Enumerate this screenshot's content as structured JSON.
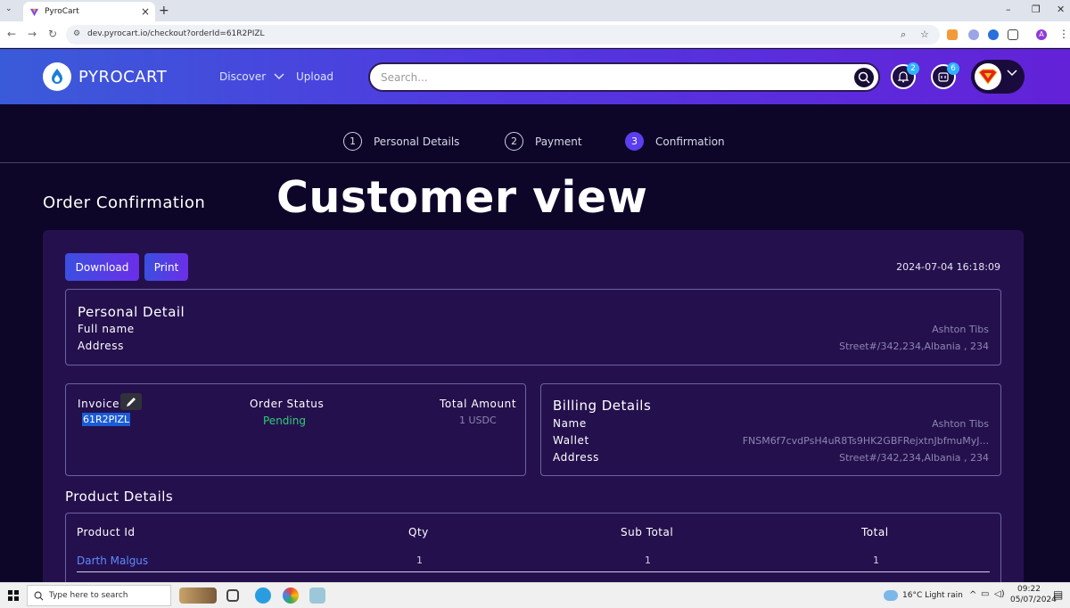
{
  "browser": {
    "tab_title": "PyroCart",
    "url": "dev.pyrocart.io/checkout?orderId=61R2PIZL",
    "profile_initial": "A"
  },
  "header": {
    "brand": "PYROCART",
    "nav": {
      "discover": "Discover",
      "upload": "Upload"
    },
    "search_placeholder": "Search...",
    "notifications_count": "2",
    "cart_count": "6"
  },
  "stepper": [
    {
      "num": "1",
      "label": "Personal Details"
    },
    {
      "num": "2",
      "label": "Payment"
    },
    {
      "num": "3",
      "label": "Confirmation"
    }
  ],
  "page": {
    "title": "Order Confirmation",
    "overlay": "Customer view"
  },
  "actions": {
    "download": "Download",
    "print": "Print",
    "timestamp": "2024-07-04 16:18:09"
  },
  "personal": {
    "title": "Personal Detail",
    "full_name_label": "Full name",
    "address_label": "Address",
    "full_name": "Ashton Tibs",
    "address": "Street#/342,234,Albania , 234"
  },
  "invoice": {
    "invoice_label": "Invoice",
    "invoice_id": "61R2PIZL",
    "status_label": "Order Status",
    "status": "Pending",
    "total_label": "Total Amount",
    "total": "1 USDC"
  },
  "billing": {
    "title": "Billing Details",
    "name_label": "Name",
    "wallet_label": "Wallet",
    "address_label": "Address",
    "name": "Ashton Tibs",
    "wallet": "FNSM6f7cvdPsH4uR8Ts9HK2GBFRejxtnJbfmuMyJ...",
    "address": "Street#/342,234,Albania , 234"
  },
  "products": {
    "title": "Product Details",
    "headers": [
      "Product Id",
      "Qty",
      "Sub Total",
      "Total"
    ],
    "rows": [
      {
        "product": "Darth Malgus",
        "qty": "1",
        "subtotal": "1",
        "total": "1"
      }
    ]
  },
  "taskbar": {
    "search_text": "Type here to search",
    "weather": "16°C  Light rain",
    "time": "09:22",
    "date": "05/07/2024"
  },
  "colors": {
    "header_start": "#3a5bd9",
    "header_end": "#6322d8",
    "page_bg": "#0d0628",
    "card_bg": "#25104e",
    "status_pending": "#2ecc71",
    "link": "#5b8cff"
  }
}
